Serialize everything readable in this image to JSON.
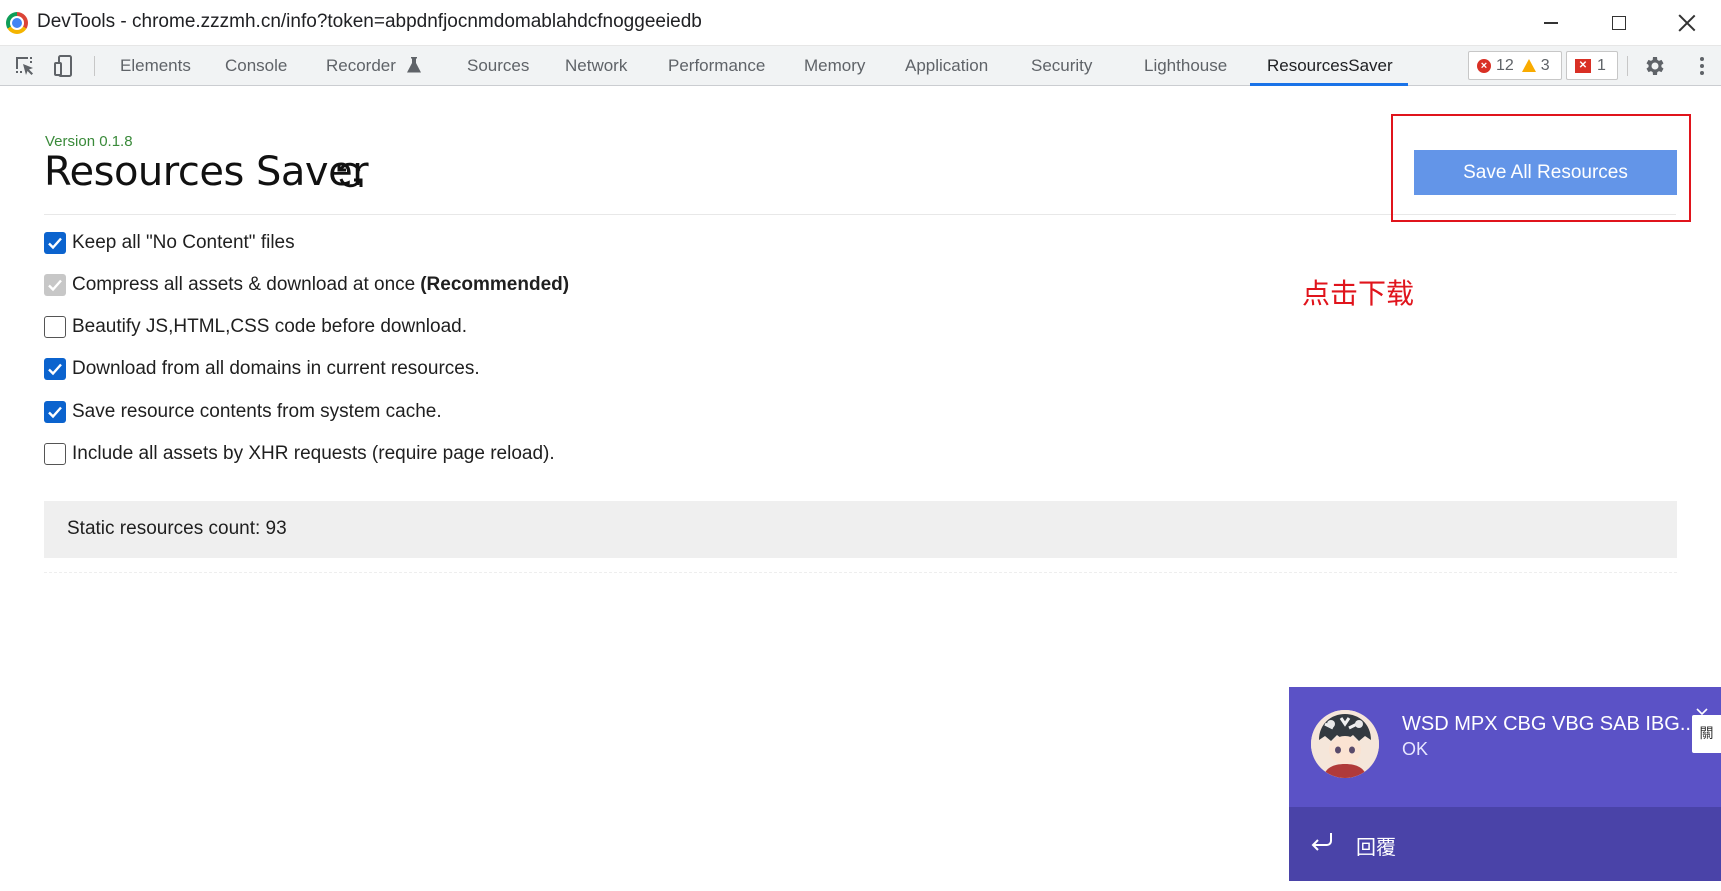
{
  "window": {
    "title": "DevTools - chrome.zzzmh.cn/info?token=abpdnfjocnmdomablahdcfnoggeeiedb",
    "side_char": "關"
  },
  "toolbar": {
    "tabs": [
      {
        "label": "Elements"
      },
      {
        "label": "Console"
      },
      {
        "label": "Recorder"
      },
      {
        "label": "Sources"
      },
      {
        "label": "Network"
      },
      {
        "label": "Performance"
      },
      {
        "label": "Memory"
      },
      {
        "label": "Application"
      },
      {
        "label": "Security"
      },
      {
        "label": "Lighthouse"
      },
      {
        "label": "ResourcesSaver"
      }
    ],
    "active_tab": "ResourcesSaver",
    "error_count": "12",
    "warning_count": "3",
    "issue_count": "1"
  },
  "panel": {
    "version": "Version 0.1.8",
    "title": "Resources Saver",
    "save_button": "Save All Resources",
    "annotation": "点击下载",
    "options": [
      {
        "label": "Keep all \"No Content\" files",
        "state": "checked",
        "extra": ""
      },
      {
        "label": "Compress all assets & download at once",
        "state": "disabled-checked",
        "extra": "(Recommended)"
      },
      {
        "label": "Beautify JS,HTML,CSS code before download.",
        "state": "unchecked",
        "extra": ""
      },
      {
        "label": "Download from all domains in current resources.",
        "state": "checked",
        "extra": ""
      },
      {
        "label": "Save resource contents from system cache.",
        "state": "checked",
        "extra": ""
      },
      {
        "label": "Include all assets by XHR requests (require page reload).",
        "state": "unchecked",
        "extra": ""
      }
    ],
    "static_count_label": "Static resources count: 93"
  },
  "notification": {
    "title": "WSD MPX CBG VBG SAB IBG...",
    "body": "OK",
    "reply_label": "回覆"
  },
  "colors": {
    "accent_blue": "#1a73e8",
    "save_button": "#6395e8",
    "annotation_red": "#e0141c",
    "toast_bg": "#5b52c6"
  }
}
